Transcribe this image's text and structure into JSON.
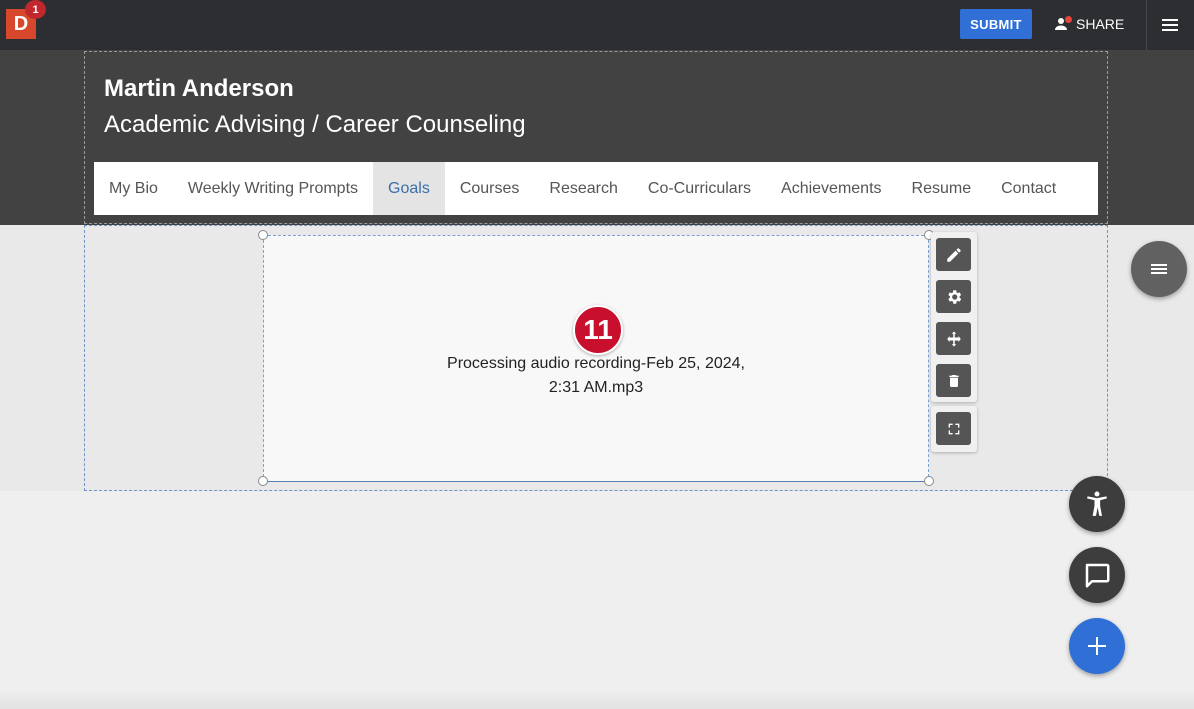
{
  "topbar": {
    "logo_letter": "D",
    "notification_count": "1",
    "submit_label": "SUBMIT",
    "share_label": "SHARE"
  },
  "header": {
    "name": "Martin Anderson",
    "subtitle": "Academic Advising / Career Counseling"
  },
  "nav": {
    "items": [
      {
        "label": "My Bio"
      },
      {
        "label": "Weekly Writing Prompts"
      },
      {
        "label": "Goals",
        "active": true
      },
      {
        "label": "Courses"
      },
      {
        "label": "Research"
      },
      {
        "label": "Co-Curriculars"
      },
      {
        "label": "Achievements"
      },
      {
        "label": "Resume"
      },
      {
        "label": "Contact"
      }
    ]
  },
  "block": {
    "badge": "11",
    "line1": "Processing audio recording-Feb 25, 2024,",
    "line2": "2:31 AM.mp3"
  },
  "tools": {
    "icons": [
      "pencil-icon",
      "gear-icon",
      "move-icon",
      "trash-icon",
      "fullscreen-icon"
    ]
  },
  "colors": {
    "topbar": "#2d2e31",
    "header": "#424242",
    "accent": "#2f6fd6",
    "badge": "#c8102e",
    "logo": "#d6472b"
  }
}
